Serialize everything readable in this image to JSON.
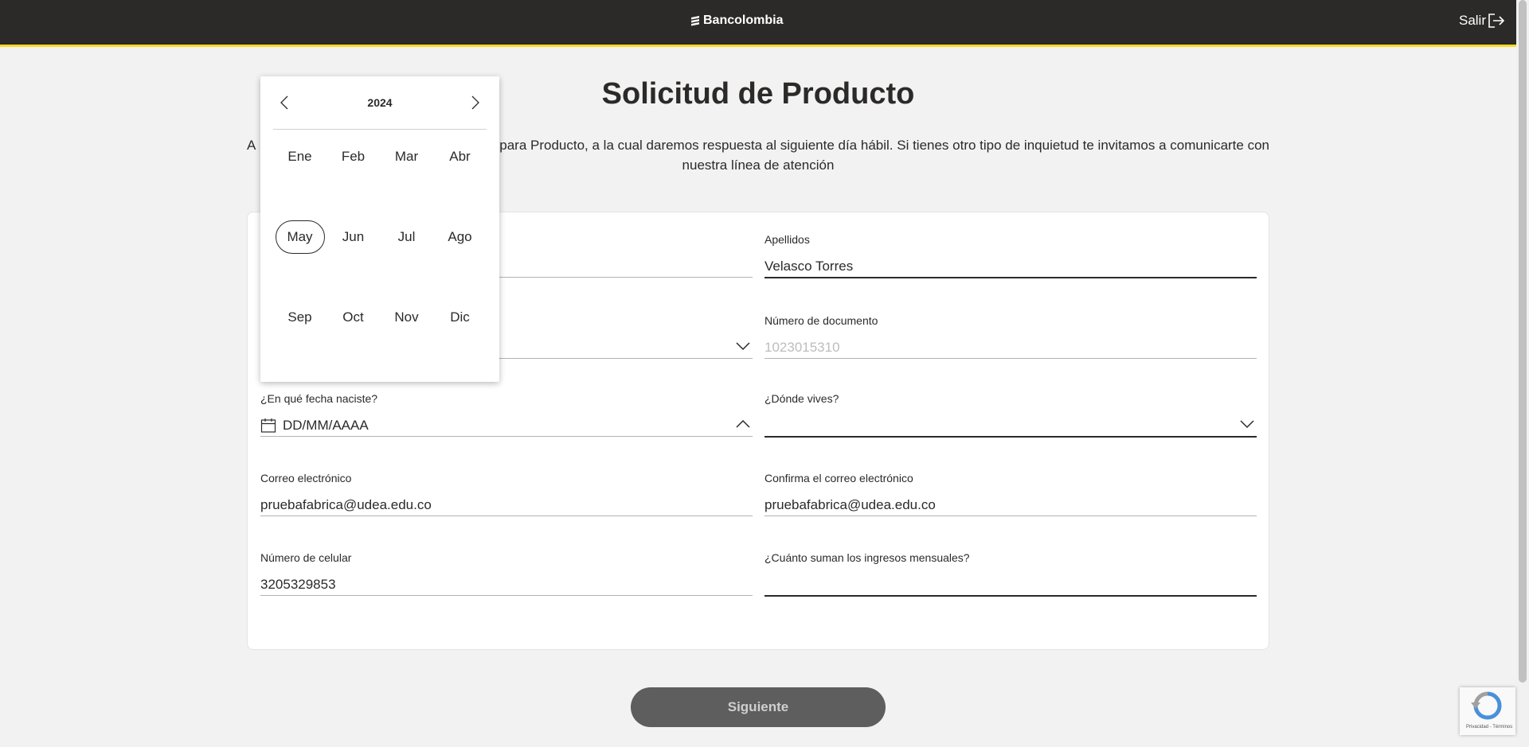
{
  "header": {
    "brand": "Bancolombia",
    "exit_label": "Salir"
  },
  "page": {
    "title": "Solicitud de Producto",
    "intro_line1": "A... [obscured] ...citud para Producto, a la cual daremos respuesta al siguiente día hábil. Si tienes otro tipo de inquietud te invitamos a comunicarte con",
    "intro_line1_visible_left": "A",
    "intro_line1_visible_right": "citud para Producto, a la cual daremos respuesta al siguiente día hábil. Si tienes otro tipo de inquietud te invitamos a comunicarte con",
    "intro_line2": "nuestra línea de atención"
  },
  "form": {
    "apellidos": {
      "label": "Apellidos",
      "value": "Velasco Torres"
    },
    "numero_documento": {
      "label": "Número de documento",
      "value": "1023015310"
    },
    "fecha_nacimiento": {
      "label": "¿En qué fecha naciste?",
      "placeholder": "DD/MM/AAAA"
    },
    "donde_vives": {
      "label": "¿Dónde vives?",
      "value": ""
    },
    "correo": {
      "label": "Correo electrónico",
      "value": "pruebafabrica@udea.edu.co"
    },
    "confirma_correo": {
      "label": "Confirma el correo electrónico",
      "value": "pruebafabrica@udea.edu.co"
    },
    "celular": {
      "label": "Número de celular",
      "value": "3205329853"
    },
    "ingresos": {
      "label": "¿Cuánto suman los ingresos mensuales?",
      "value": ""
    },
    "next_button": "Siguiente"
  },
  "datepicker": {
    "year": "2024",
    "months": [
      "Ene",
      "Feb",
      "Mar",
      "Abr",
      "May",
      "Jun",
      "Jul",
      "Ago",
      "Sep",
      "Oct",
      "Nov",
      "Dic"
    ],
    "selected_month": "May"
  },
  "recaptcha": {
    "text": "Privacidad - Términos"
  },
  "colors": {
    "header_bg": "#2c2a29",
    "accent_yellow": "#fdda24",
    "button_bg": "#5e5e5e"
  }
}
